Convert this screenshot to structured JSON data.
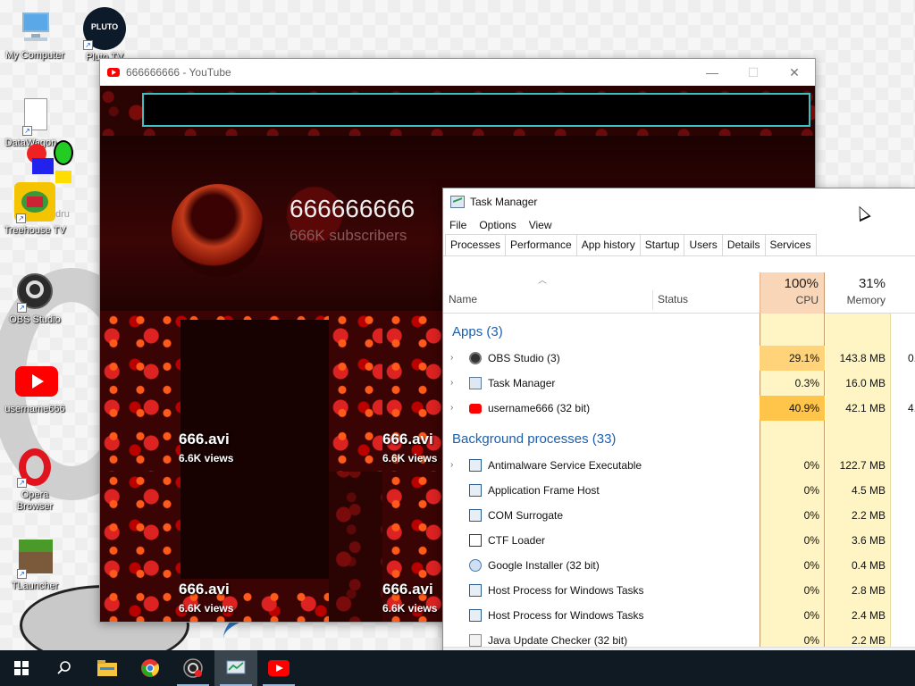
{
  "desktop": {
    "icons": [
      {
        "label": "My Computer",
        "icon": "computer-icon"
      },
      {
        "label": "Pluto TV",
        "icon": "pluto-tv-icon",
        "logo_text": "PLUTO"
      },
      {
        "label": "DataWagon...",
        "icon": "document-icon"
      },
      {
        "label": "Treehouse TV",
        "icon": "treehouse-tv-icon"
      },
      {
        "label": "OBS Studio",
        "icon": "obs-icon"
      },
      {
        "label": "username666",
        "icon": "youtube-icon"
      },
      {
        "label": "Opera\nBrowser",
        "icon": "opera-icon"
      },
      {
        "label": "TLauncher",
        "icon": "minecraft-icon"
      }
    ],
    "overlap_text": "dru"
  },
  "youtube_window": {
    "title": "666666666 - YouTube",
    "channel_name": "666666666",
    "subscribers": "666K subscribers",
    "videos": [
      {
        "title": "666.avi",
        "views": "6.6K views"
      },
      {
        "title": "666.avi",
        "views": "6.6K views"
      },
      {
        "title": "666.avi",
        "views": "6.6K views"
      },
      {
        "title": "666.avi",
        "views": "6.6K views"
      }
    ]
  },
  "task_manager": {
    "title": "Task Manager",
    "menu": [
      "File",
      "Options",
      "View"
    ],
    "tabs": [
      "Processes",
      "Performance",
      "App history",
      "Startup",
      "Users",
      "Details",
      "Services"
    ],
    "active_tab": "Processes",
    "columns": {
      "name": "Name",
      "status": "Status",
      "cpu_pct": "100%",
      "cpu": "CPU",
      "memory_pct": "31%",
      "memory": "Memory"
    },
    "apps_group": "Apps (3)",
    "apps": [
      {
        "name": "OBS Studio (3)",
        "cpu": "29.1%",
        "memory": "143.8 MB",
        "extra": "0.",
        "icon": "obs-icon"
      },
      {
        "name": "Task Manager",
        "cpu": "0.3%",
        "memory": "16.0 MB",
        "extra": "",
        "icon": "task-manager-icon"
      },
      {
        "name": "username666 (32 bit)",
        "cpu": "40.9%",
        "memory": "42.1 MB",
        "extra": "4.",
        "icon": "youtube-icon"
      }
    ],
    "background_group": "Background processes (33)",
    "background": [
      {
        "name": "Antimalware Service Executable",
        "cpu": "0%",
        "memory": "122.7 MB",
        "expandable": true
      },
      {
        "name": "Application Frame Host",
        "cpu": "0%",
        "memory": "4.5 MB",
        "expandable": false
      },
      {
        "name": "COM Surrogate",
        "cpu": "0%",
        "memory": "2.2 MB",
        "expandable": false
      },
      {
        "name": "CTF Loader",
        "cpu": "0%",
        "memory": "3.6 MB",
        "expandable": false
      },
      {
        "name": "Google Installer (32 bit)",
        "cpu": "0%",
        "memory": "0.4 MB",
        "expandable": false
      },
      {
        "name": "Host Process for Windows Tasks",
        "cpu": "0%",
        "memory": "2.8 MB",
        "expandable": false
      },
      {
        "name": "Host Process for Windows Tasks",
        "cpu": "0%",
        "memory": "2.4 MB",
        "expandable": false
      },
      {
        "name": "Java Update Checker (32 bit)",
        "cpu": "0%",
        "memory": "2.2 MB",
        "expandable": false
      }
    ]
  },
  "taskbar": {
    "items": [
      "start-icon",
      "search-icon",
      "file-explorer-icon",
      "chrome-icon",
      "obs-icon",
      "task-manager-icon",
      "youtube-icon"
    ]
  },
  "colors": {
    "cpu_header": "#f9d6b8",
    "cpu_high": "#ffd37a",
    "cpu_mid": "#ffe08a",
    "cell_low": "#fff4c4",
    "group_blue": "#1c5fb0",
    "taskbar": "#101a22"
  }
}
